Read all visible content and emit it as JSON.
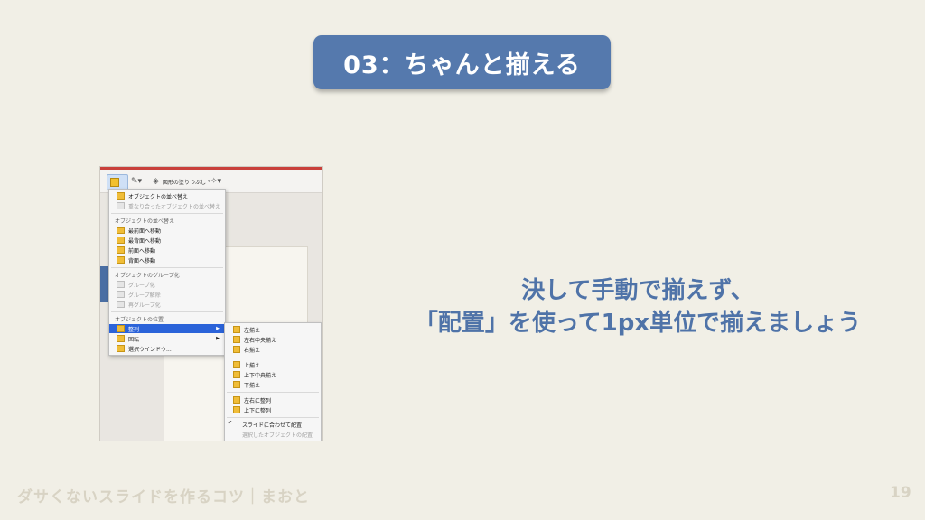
{
  "slide": {
    "title": "03：ちゃんと揃える",
    "message_line1": "決して手動で揃えず、",
    "message_line2": "「配置」を使って1px単位で揃えましょう",
    "footer_left": "ダサくないスライドを作るコツ｜まおと",
    "page_number": "19"
  },
  "screenshot": {
    "toolbar_label": "図形の塗りつぶし",
    "menu": {
      "item_reorder": "オブジェクトの並べ替え",
      "item_reorder_overlap": "重なり合ったオブジェクトの並べ替え",
      "section_reorder": "オブジェクトの並べ替え",
      "item_front": "最前面へ移動",
      "item_back": "最背面へ移動",
      "item_forward": "前面へ移動",
      "item_backward": "背面へ移動",
      "section_group": "オブジェクトのグループ化",
      "item_group": "グループ化",
      "item_ungroup": "グループ解除",
      "item_regroup": "再グループ化",
      "section_position": "オブジェクトの位置",
      "item_align": "整列",
      "item_rotate": "回転",
      "item_selection_window": "選択ウインドウ..."
    },
    "submenu": {
      "align_left": "左揃え",
      "align_center": "左右中央揃え",
      "align_right": "右揃え",
      "align_top": "上揃え",
      "align_middle": "上下中央揃え",
      "align_bottom": "下揃え",
      "distribute_h": "左右に整列",
      "distribute_v": "上下に整列",
      "align_to_slide": "スライドに合わせて配置",
      "align_selected": "選択したオブジェクトの配置"
    }
  },
  "colors": {
    "background": "#f1efe6",
    "title_box": "#5579ad",
    "message_text": "#4f73a8",
    "footer_text": "#d8d3c4",
    "menu_highlight": "#2b63d9"
  }
}
